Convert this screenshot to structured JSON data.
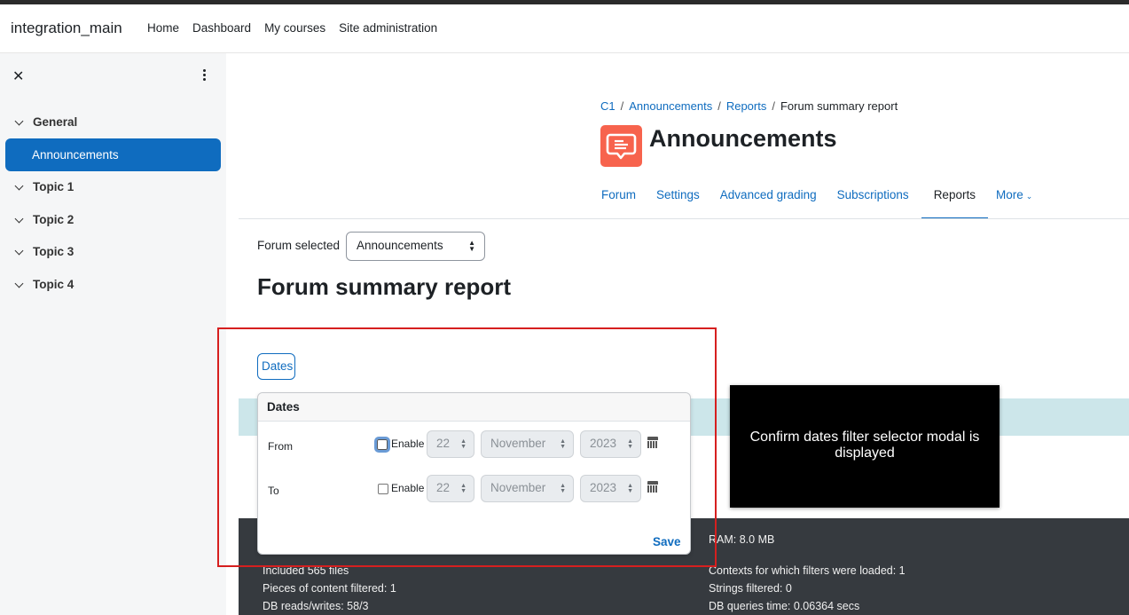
{
  "navbar": {
    "brand": "integration_main",
    "links": [
      "Home",
      "Dashboard",
      "My courses",
      "Site administration"
    ]
  },
  "drawer": {
    "close_icon": "close-icon",
    "menu_icon": "kebab-menu-icon",
    "sections": [
      {
        "label": "General"
      },
      {
        "label": "Topic 1"
      },
      {
        "label": "Topic 2"
      },
      {
        "label": "Topic 3"
      },
      {
        "label": "Topic 4"
      }
    ],
    "active_item": "Announcements"
  },
  "breadcrumb": [
    "C1",
    "Announcements",
    "Reports",
    "Forum summary report"
  ],
  "page": {
    "title": "Announcements",
    "icon": "forum-icon",
    "tabs": [
      "Forum",
      "Settings",
      "Advanced grading",
      "Subscriptions",
      "Reports",
      "More"
    ],
    "active_tab": "Reports"
  },
  "forum_selector": {
    "label": "Forum selected",
    "value": "Announcements"
  },
  "report": {
    "title": "Forum summary report",
    "dates_button": "Dates"
  },
  "dates_popover": {
    "title": "Dates",
    "from": {
      "label": "From",
      "enable_label": "Enable",
      "day": "22",
      "month": "November",
      "year": "2023",
      "enabled": false
    },
    "to": {
      "label": "To",
      "enable_label": "Enable",
      "day": "22",
      "month": "November",
      "year": "2023",
      "enabled": false
    },
    "save_label": "Save"
  },
  "footer": {
    "ram": "RAM: 8.0 MB",
    "included_files": "Included 565 files",
    "contexts": "Contexts for which filters were loaded: 1",
    "pieces": "Pieces of content filtered: 1",
    "strings": "Strings filtered: 0",
    "db_rw": "DB reads/writes: 58/3",
    "db_time": "DB queries time: 0.06364 secs"
  },
  "annotation": {
    "caption": "Confirm dates filter selector modal is displayed",
    "highlight_color": "#d61f1f"
  },
  "colors": {
    "primary": "#0f6cbf",
    "forum_icon_bg": "#f7634d",
    "footer_bg": "#363a3f",
    "info_band": "#cce6ea"
  }
}
